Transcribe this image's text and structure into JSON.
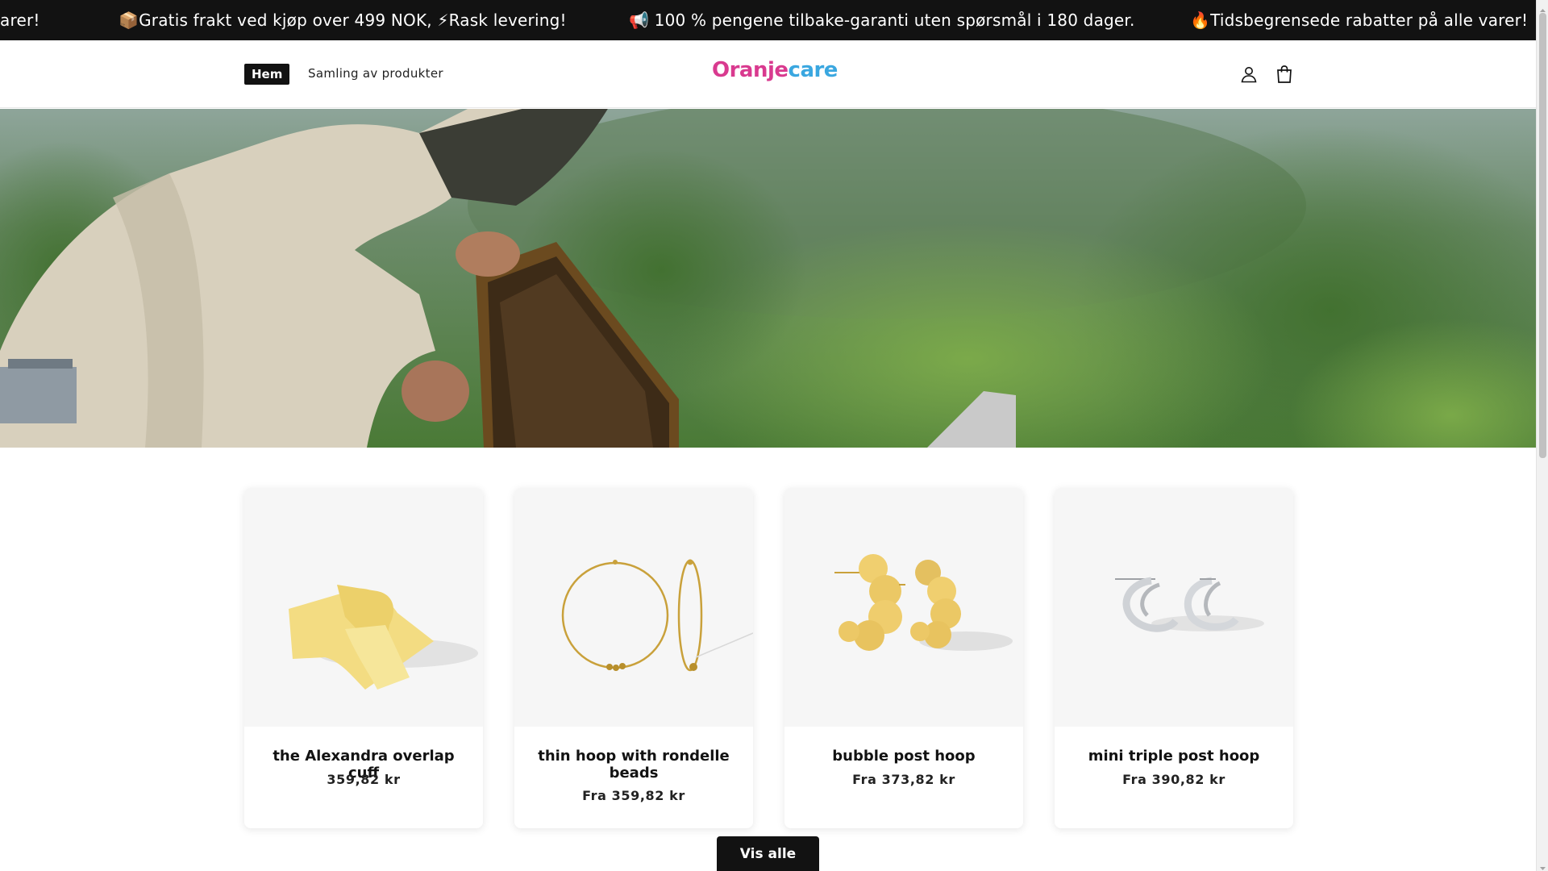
{
  "announcement": {
    "messages": [
      "arer!",
      "📦Gratis frakt ved kjøp over 499 NOK, ⚡Rask levering!",
      "📢 100 % pengene tilbake-garanti uten spørsmål i 180 dager.",
      "🔥Tidsbegrensede rabatter på alle varer!"
    ]
  },
  "header": {
    "nav": {
      "home": "Hem",
      "collection": "Samling av produkter"
    },
    "logo": {
      "part1": "Oranje",
      "part2": "care"
    },
    "icons": {
      "account": "account-icon",
      "cart": "cart-icon"
    }
  },
  "hero": {
    "image": "beekeeper-holding-honeycomb-frame"
  },
  "products": [
    {
      "title": "the Alexandra overlap cuff",
      "price": "359,82 kr",
      "image": "gold-overlap-cuff"
    },
    {
      "title": "thin hoop with rondelle beads",
      "price": "Fra 359,82 kr",
      "image": "gold-thin-hoop-earrings"
    },
    {
      "title": "bubble post hoop",
      "price": "Fra 373,82 kr",
      "image": "gold-bubble-hoop-earrings"
    },
    {
      "title": "mini triple post hoop",
      "price": "Fra 390,82 kr",
      "image": "silver-triple-hoop-earrings"
    }
  ],
  "view_all": "Vis alle",
  "colors": {
    "bar": "#121212",
    "logo_pink": "#d93a8f",
    "logo_blue": "#3aa7e0"
  }
}
